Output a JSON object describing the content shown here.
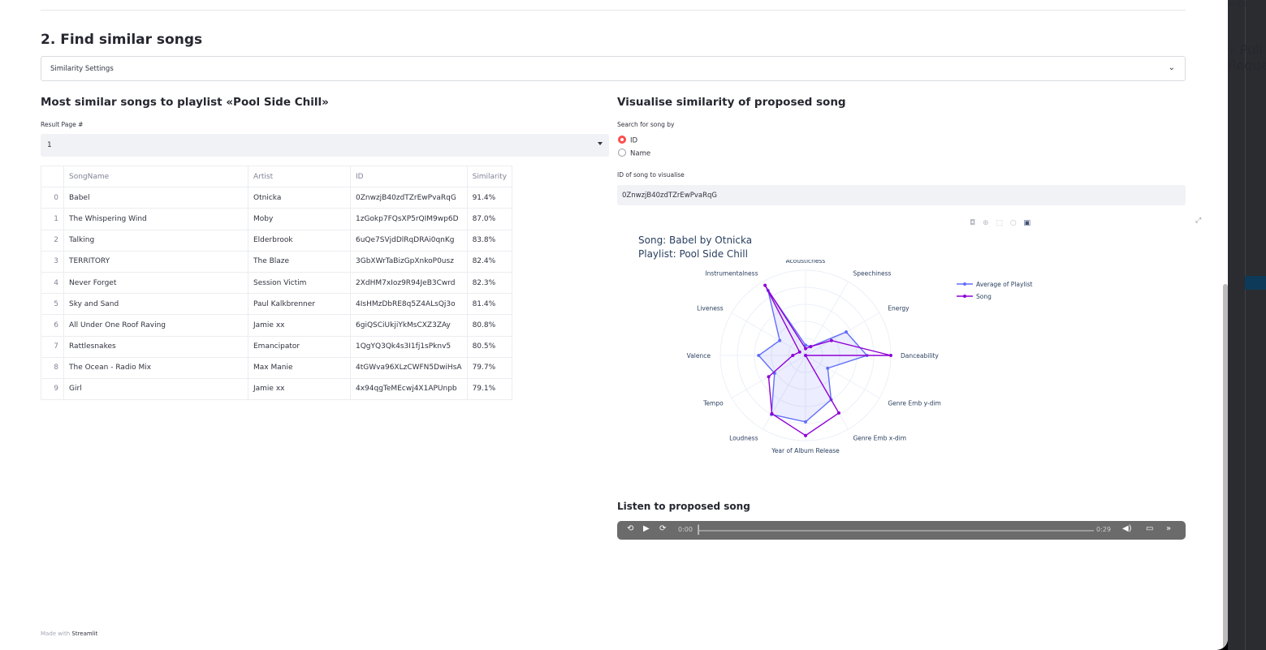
{
  "section": {
    "title": "2. Find similar songs",
    "expander_label": "Similarity Settings"
  },
  "left": {
    "title": "Most similar songs to playlist «Pool Side Chill»",
    "page_label": "Result Page #",
    "page_value": "1",
    "columns": [
      "SongName",
      "Artist",
      "ID",
      "Similarity"
    ],
    "rows": [
      {
        "idx": "0",
        "song": "Babel",
        "artist": "Otnicka",
        "id": "0ZnwzjB40zdTZrEwPvaRqG",
        "sim": "91.4%"
      },
      {
        "idx": "1",
        "song": "The Whispering Wind",
        "artist": "Moby",
        "id": "1zGokp7FQsXP5rQIM9wp6D",
        "sim": "87.0%"
      },
      {
        "idx": "2",
        "song": "Talking",
        "artist": "Elderbrook",
        "id": "6uQe7SVjdDlRqDRAi0qnKg",
        "sim": "83.8%"
      },
      {
        "idx": "3",
        "song": "TERRITORY",
        "artist": "The Blaze",
        "id": "3GbXWrTaBizGpXnkoP0usz",
        "sim": "82.4%"
      },
      {
        "idx": "4",
        "song": "Never Forget",
        "artist": "Session Victim",
        "id": "2XdHM7xIoz9R94JeB3Cwrd",
        "sim": "82.3%"
      },
      {
        "idx": "5",
        "song": "Sky and Sand",
        "artist": "Paul Kalkbrenner",
        "id": "4IsHMzDbRE8q5Z4ALsQj3o",
        "sim": "81.4%"
      },
      {
        "idx": "6",
        "song": "All Under One Roof Raving",
        "artist": "Jamie xx",
        "id": "6giQSCiUkjiYkMsCXZ3ZAy",
        "sim": "80.8%"
      },
      {
        "idx": "7",
        "song": "Rattlesnakes",
        "artist": "Emancipator",
        "id": "1QgYQ3Qk4s3I1fj1sPknv5",
        "sim": "80.5%"
      },
      {
        "idx": "8",
        "song": "The Ocean - Radio Mix",
        "artist": "Max Manie",
        "id": "4tGWva96XLzCWFN5DwiHsA",
        "sim": "79.7%"
      },
      {
        "idx": "9",
        "song": "Girl",
        "artist": "Jamie xx",
        "id": "4x94qgTeMEcwj4X1APUnpb",
        "sim": "79.1%"
      }
    ]
  },
  "right": {
    "title": "Visualise similarity of proposed song",
    "search_label": "Search for song by",
    "radio_options": [
      "ID",
      "Name"
    ],
    "radio_selected": "ID",
    "id_label": "ID of song to visualise",
    "id_value": "0ZnwzjB40zdTZrEwPvaRqG",
    "listen_title": "Listen to proposed song"
  },
  "chart_data": {
    "type": "radar",
    "title": "Song: Babel by Otnicka",
    "subtitle": "Playlist: Pool Side Chill",
    "axes": [
      "Acousticness",
      "Speechiness",
      "Energy",
      "Danceability",
      "Genre Emb y-dim",
      "Genre Emb x-dim",
      "Year of Album Release",
      "Loudness",
      "Tempo",
      "Valence",
      "Liveness",
      "Instrumentalness"
    ],
    "series": [
      {
        "name": "Average of Playlist",
        "color": "#636efa",
        "values": [
          0.12,
          0.12,
          0.55,
          0.72,
          0.3,
          0.6,
          0.78,
          0.8,
          0.42,
          0.55,
          0.35,
          0.88
        ]
      },
      {
        "name": "Song",
        "color": "#8f00d6",
        "values": [
          0.08,
          0.12,
          0.35,
          1.0,
          0.0,
          0.78,
          0.94,
          0.79,
          0.5,
          0.15,
          0.08,
          0.95
        ]
      }
    ],
    "range": [
      0,
      1
    ],
    "legend_position": "top-right"
  },
  "audio": {
    "current_time": "0:00",
    "duration": "0:29",
    "progress": 0
  },
  "footer": {
    "prefix": "Made with",
    "brand": "Streamlit"
  },
  "sidebar": {
    "label_top": "Co",
    "label_pr": "Pull Requests"
  }
}
